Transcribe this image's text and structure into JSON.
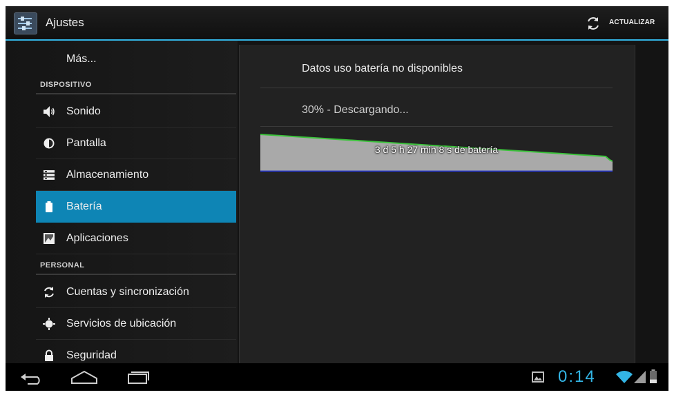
{
  "actionbar": {
    "title": "Ajustes",
    "refresh_label": "ACTUALIZAR"
  },
  "sidebar": {
    "more_label": "Más...",
    "section_device": "DISPOSITIVO",
    "section_personal": "PERSONAL",
    "items": [
      {
        "label": "Sonido",
        "icon": "speaker-icon"
      },
      {
        "label": "Pantalla",
        "icon": "brightness-icon"
      },
      {
        "label": "Almacenamiento",
        "icon": "storage-icon"
      },
      {
        "label": "Batería",
        "icon": "battery-icon",
        "selected": true
      },
      {
        "label": "Aplicaciones",
        "icon": "apps-icon"
      },
      {
        "label": "Cuentas y sincronización",
        "icon": "sync-icon"
      },
      {
        "label": "Servicios de ubicación",
        "icon": "location-icon"
      },
      {
        "label": "Seguridad",
        "icon": "lock-icon"
      }
    ]
  },
  "content": {
    "usage_unavailable": "Datos uso batería no disponibles",
    "battery_status": "30% - Descargando...",
    "battery_level_percent": 30,
    "graph_label": "3 d 5 h 27 min 8 s de batería"
  },
  "statusbar": {
    "time": "0:14"
  },
  "colors": {
    "accent": "#33b5e5",
    "selected": "#0e85b5",
    "graph_fill": "#a9a9a9",
    "graph_line": "#3cc33c",
    "graph_baseline": "#2a3ad0"
  }
}
